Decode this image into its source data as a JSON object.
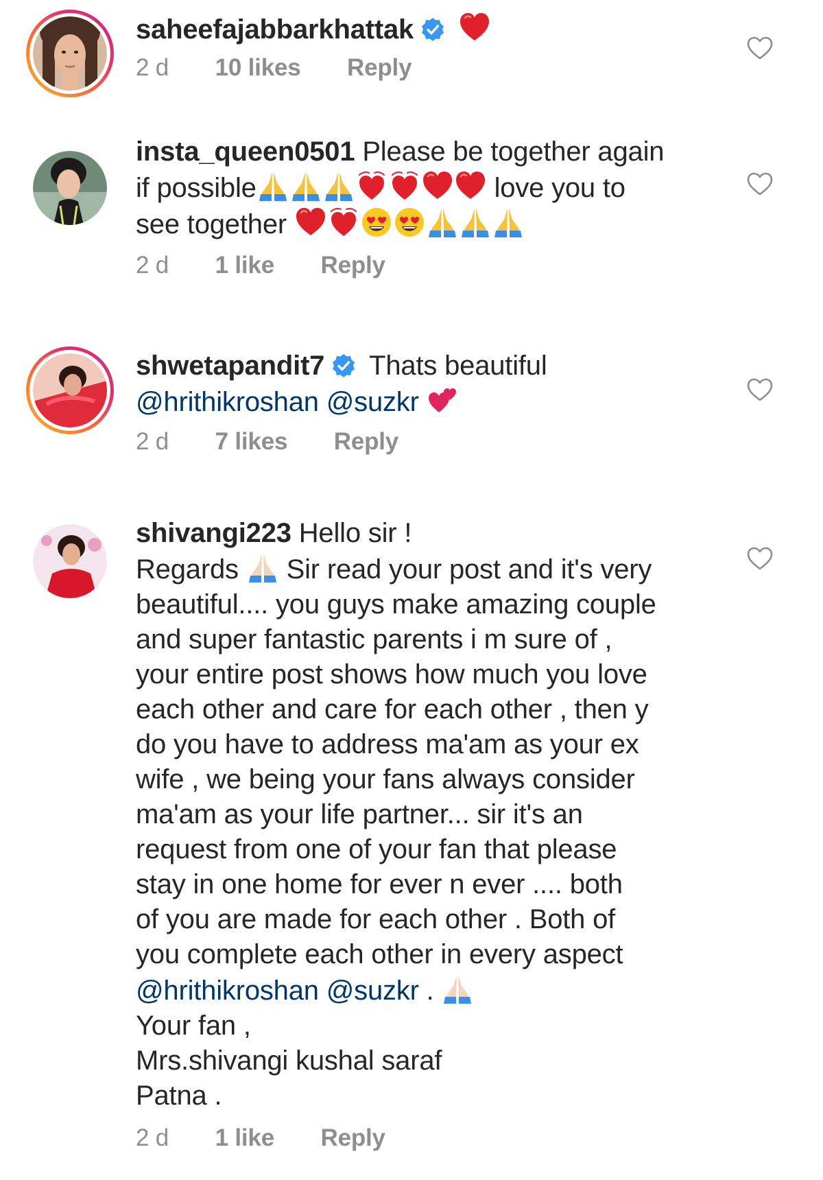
{
  "comments": [
    {
      "username": "saheefajabbarkhattak",
      "verified": true,
      "time": "2 d",
      "likes": "10 likes",
      "reply": "Reply"
    },
    {
      "username": "insta_queen0501",
      "verified": false,
      "text_parts": [
        "Please be together again",
        "if possible",
        "love you to",
        "see together"
      ],
      "time": "2 d",
      "likes": "1 like",
      "reply": "Reply"
    },
    {
      "username": "shwetapandit7",
      "verified": true,
      "text_parts": [
        "Thats beautiful"
      ],
      "mentions": [
        "@hrithikroshan",
        "@suzkr"
      ],
      "time": "2 d",
      "likes": "7 likes",
      "reply": "Reply"
    },
    {
      "username": "shivangi223",
      "verified": false,
      "text_lines": [
        "Hello sir !",
        "Regards",
        "Sir read your post and it's very",
        "beautiful.... you guys make amazing couple",
        "and super fantastic parents i m sure of ,",
        "your entire post shows how much you love",
        "each other and care for each other , then y",
        "do you have to address ma'am as your ex",
        "wife , we being your fans always consider",
        "ma'am as your life partner... sir it's an",
        "request from one of your fan that please",
        "stay in one home for ever n ever .... both",
        "of you are made for each other . Both of",
        "you complete each other in every aspect",
        ".",
        "Your fan ,",
        "Mrs.shivangi kushal saraf",
        "Patna ."
      ],
      "mentions": [
        "@hrithikroshan",
        "@suzkr"
      ],
      "time": "2 d",
      "likes": "1 like",
      "reply": "Reply"
    }
  ],
  "icons": {
    "like": "heart-outline-icon",
    "verified": "verified-badge-icon"
  },
  "colors": {
    "text": "#262626",
    "meta": "#8e8e8e",
    "mention": "#00376b",
    "verified": "#3897f0",
    "heart_emoji": "#e0202a"
  }
}
